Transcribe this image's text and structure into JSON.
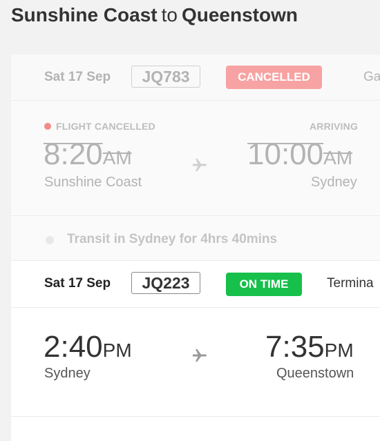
{
  "header": {
    "origin": "Sunshine Coast",
    "connector": "to",
    "destination": "Queenstown"
  },
  "leg1": {
    "date": "Sat 17 Sep",
    "flight_number": "JQ783",
    "status": "CANCELLED",
    "extra_text": "Ga",
    "status_label": "FLIGHT CANCELLED",
    "arriving_label": "ARRIVING",
    "depart_time": "8:20",
    "depart_ampm": "AM",
    "depart_city": "Sunshine Coast",
    "arrive_time": "10:00",
    "arrive_ampm": "AM",
    "arrive_city": "Sydney"
  },
  "transit": {
    "text": "Transit in Sydney for 4hrs 40mins"
  },
  "leg2": {
    "date": "Sat 17 Sep",
    "flight_number": "JQ223",
    "status": "ON TIME",
    "extra_text": "Termina",
    "depart_time": "2:40",
    "depart_ampm": "PM",
    "depart_city": "Sydney",
    "arrive_time": "7:35",
    "arrive_ampm": "PM",
    "arrive_city": "Queenstown"
  },
  "colors": {
    "cancelled_badge": "#f7a3a3",
    "ontime_badge": "#16c04b",
    "cancelled_dot": "#f28b8b",
    "muted_text": "#b3b3b3",
    "primary_text": "#333333"
  },
  "icons": [
    "plane-icon",
    "status-dot-icon",
    "transit-dot-icon"
  ]
}
